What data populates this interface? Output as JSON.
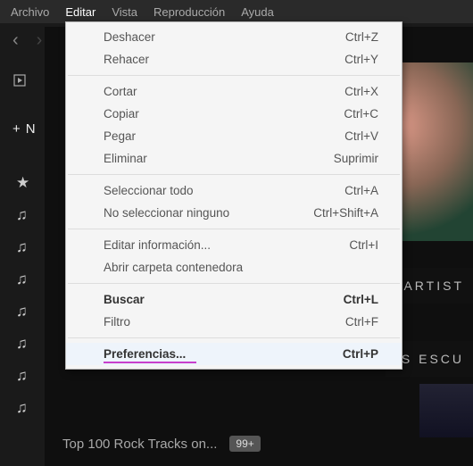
{
  "menubar": {
    "items": [
      "Archivo",
      "Editar",
      "Vista",
      "Reproducción",
      "Ayuda"
    ],
    "active_index": 1
  },
  "nav": {
    "back": "‹",
    "forward": "›"
  },
  "new_button": {
    "icon": "+",
    "label": "N"
  },
  "sidebar": {
    "star": "★",
    "notes": [
      "♫",
      "♫",
      "♫",
      "♫",
      "♫",
      "♫",
      "♫"
    ]
  },
  "dropdown": {
    "groups": [
      [
        {
          "label": "Deshacer",
          "shortcut": "Ctrl+Z"
        },
        {
          "label": "Rehacer",
          "shortcut": "Ctrl+Y"
        }
      ],
      [
        {
          "label": "Cortar",
          "shortcut": "Ctrl+X"
        },
        {
          "label": "Copiar",
          "shortcut": "Ctrl+C"
        },
        {
          "label": "Pegar",
          "shortcut": "Ctrl+V"
        },
        {
          "label": "Eliminar",
          "shortcut": "Suprimir"
        }
      ],
      [
        {
          "label": "Seleccionar todo",
          "shortcut": "Ctrl+A"
        },
        {
          "label": "No seleccionar ninguno",
          "shortcut": "Ctrl+Shift+A"
        }
      ],
      [
        {
          "label": "Editar información...",
          "shortcut": "Ctrl+I"
        },
        {
          "label": "Abrir carpeta contenedora",
          "shortcut": ""
        }
      ],
      [
        {
          "label": "Buscar",
          "shortcut": "Ctrl+L",
          "bold": true
        },
        {
          "label": "Filtro",
          "shortcut": "Ctrl+F"
        }
      ],
      [
        {
          "label": "Preferencias...",
          "shortcut": "Ctrl+P",
          "highlight": true
        }
      ]
    ]
  },
  "side_labels": {
    "artists": "ARTIST",
    "listened": "S ESCU"
  },
  "bottom": {
    "playlist_title": "Top 100 Rock Tracks on...",
    "badge": "99+"
  }
}
